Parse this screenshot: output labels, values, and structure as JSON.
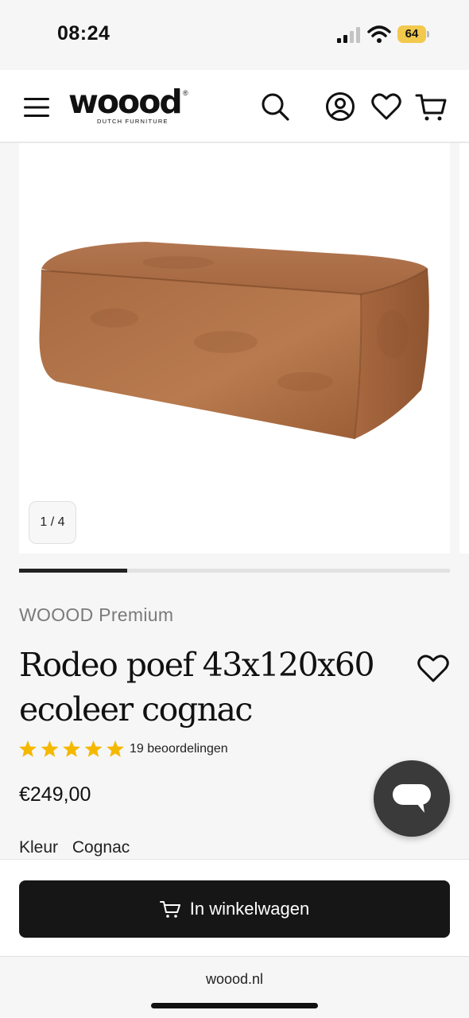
{
  "status_bar": {
    "time": "08:24",
    "battery": "64"
  },
  "header": {
    "logo_text": "woood",
    "logo_registered": "®",
    "logo_subtitle": "DUTCH FURNITURE"
  },
  "gallery": {
    "counter": "1 / 4",
    "progress": 0.25
  },
  "product": {
    "brand": "WOOOD Premium",
    "title": "Rodeo poef 43x120x60 ecoleer cognac",
    "rating": 5,
    "reviews": "19 beoordelingen",
    "price": "€249,00",
    "color_label": "Kleur",
    "color_value": "Cognac"
  },
  "cart_button": {
    "label": "In winkelwagen"
  },
  "browser": {
    "url": "woood.nl"
  },
  "colors": {
    "star": "#f5b800",
    "button": "#161616",
    "chat": "#3a3a3a"
  }
}
